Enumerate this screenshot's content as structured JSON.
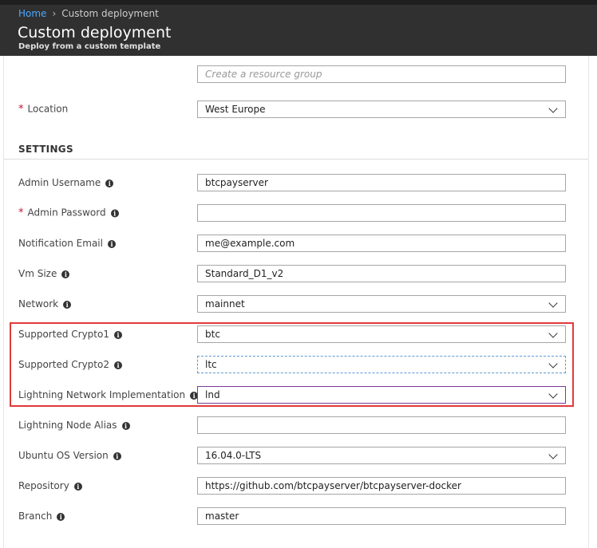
{
  "breadcrumb": {
    "home": "Home",
    "separator": "›",
    "current": "Custom deployment"
  },
  "header": {
    "title": "Custom deployment",
    "subtitle": "Deploy from a custom template"
  },
  "resource_group": {
    "placeholder": "Create a resource group",
    "value": ""
  },
  "location": {
    "label": "Location",
    "value": "West Europe",
    "required": true
  },
  "settings": {
    "title": "SETTINGS",
    "admin_username": {
      "label": "Admin Username",
      "value": "btcpayserver"
    },
    "admin_password": {
      "label": "Admin Password",
      "value": "",
      "required": true
    },
    "notification_email": {
      "label": "Notification Email",
      "value": "me@example.com"
    },
    "vm_size": {
      "label": "Vm Size",
      "value": "Standard_D1_v2"
    },
    "network": {
      "label": "Network",
      "value": "mainnet"
    },
    "supported_crypto1": {
      "label": "Supported Crypto1",
      "value": "btc"
    },
    "supported_crypto2": {
      "label": "Supported Crypto2",
      "value": "ltc"
    },
    "lightning_impl": {
      "label": "Lightning Network Implementation",
      "value": "lnd"
    },
    "lightning_alias": {
      "label": "Lightning Node Alias",
      "value": ""
    },
    "ubuntu_version": {
      "label": "Ubuntu OS Version",
      "value": "16.04.0-LTS"
    },
    "repository": {
      "label": "Repository",
      "value": "https://github.com/btcpayserver/btcpayserver-docker"
    },
    "branch": {
      "label": "Branch",
      "value": "master"
    }
  },
  "icons": {
    "info": "i",
    "required": "*"
  },
  "colors": {
    "header_bg": "#303030",
    "link": "#4aa8ff",
    "required": "#c8102e",
    "highlight": "#e03a3a"
  }
}
